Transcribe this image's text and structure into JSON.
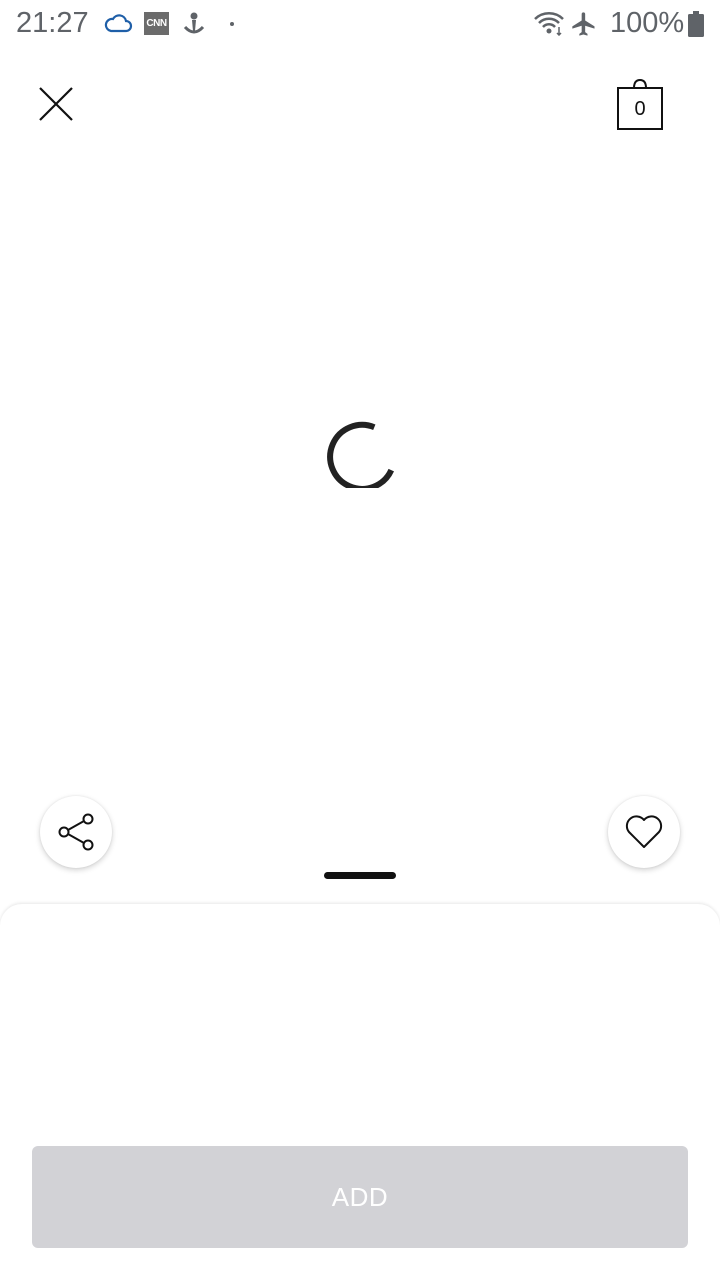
{
  "status_bar": {
    "time": "21:27",
    "cnn_label": "CNN",
    "battery": "100%",
    "icons": [
      "cloud-icon",
      "cnn-icon",
      "anchor-icon",
      "dot-icon",
      "wifi-icon",
      "airplane-icon",
      "battery-icon"
    ]
  },
  "header": {
    "close_icon": "close-icon",
    "cart_count": "0"
  },
  "content": {
    "loading": true
  },
  "actions": {
    "share_icon": "share-icon",
    "favorite_icon": "heart-icon"
  },
  "bottom_sheet": {
    "add_label": "ADD",
    "add_enabled": false
  },
  "colors": {
    "status_text": "#5f6368",
    "add_button_disabled": "#d2d2d6",
    "spinner": "#222222"
  }
}
